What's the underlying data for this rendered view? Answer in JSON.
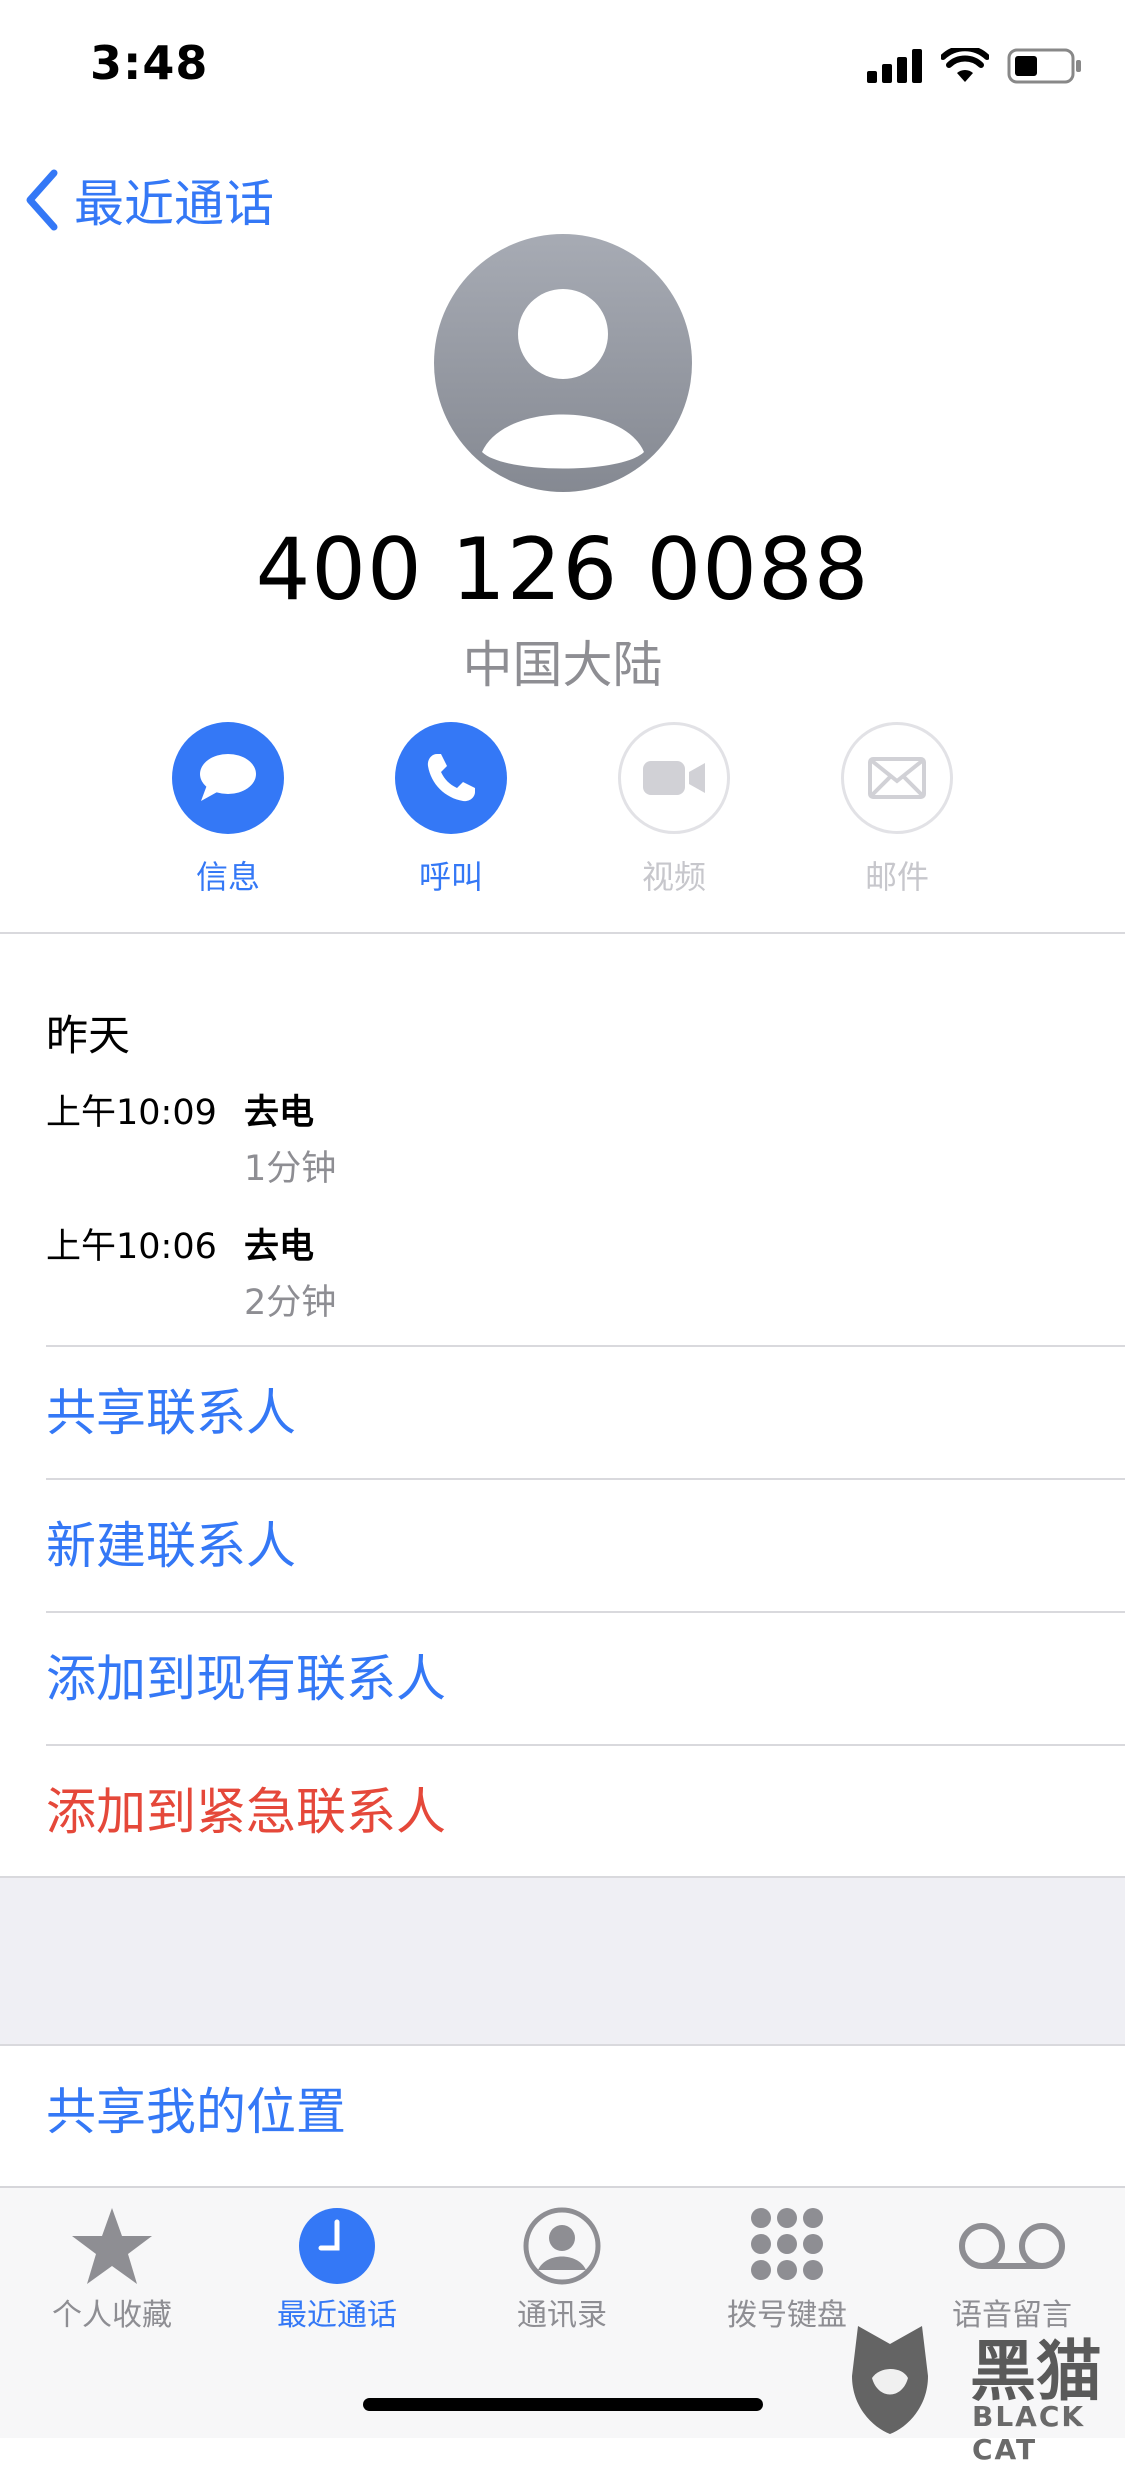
{
  "status_bar": {
    "time": "3:48"
  },
  "nav": {
    "back_label": "最近通话"
  },
  "contact": {
    "number": "400 126 0088",
    "region": "中国大陆"
  },
  "actions": [
    {
      "label": "信息",
      "icon": "message-icon",
      "enabled": true
    },
    {
      "label": "呼叫",
      "icon": "phone-icon",
      "enabled": true
    },
    {
      "label": "视频",
      "icon": "video-icon",
      "enabled": false
    },
    {
      "label": "邮件",
      "icon": "mail-icon",
      "enabled": false
    }
  ],
  "history": {
    "day": "昨天",
    "calls": [
      {
        "time": "上午10:09",
        "type": "去电",
        "duration": "1分钟"
      },
      {
        "time": "上午10:06",
        "type": "去电",
        "duration": "2分钟"
      }
    ]
  },
  "options": [
    {
      "label": "共享联系人"
    },
    {
      "label": "新建联系人"
    },
    {
      "label": "添加到现有联系人"
    },
    {
      "label": "添加到紧急联系人"
    }
  ],
  "share_location": {
    "label": "共享我的位置"
  },
  "tabs": [
    {
      "label": "个人收藏",
      "icon": "star-icon"
    },
    {
      "label": "最近通话",
      "icon": "clock-icon",
      "active": true
    },
    {
      "label": "通讯录",
      "icon": "contacts-icon"
    },
    {
      "label": "拨号键盘",
      "icon": "keypad-icon"
    },
    {
      "label": "语音留言",
      "icon": "voicemail-icon"
    }
  ],
  "watermark": {
    "text": "黑猫",
    "subtext": "BLACK CAT"
  },
  "colors": {
    "accent": "#3478f6",
    "danger": "#e5483a",
    "secondary_text": "#8e8e93"
  }
}
